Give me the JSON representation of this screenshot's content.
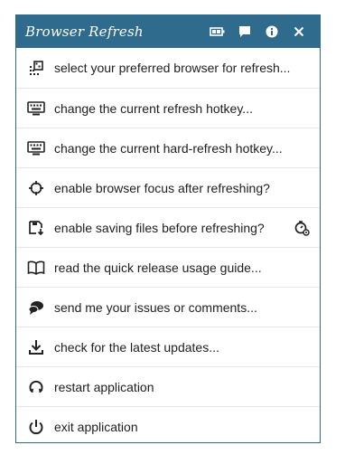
{
  "window": {
    "title": "Browser Refresh"
  },
  "titlebar": {
    "buttons": [
      {
        "icon": "battery-icon"
      },
      {
        "icon": "comment-icon"
      },
      {
        "icon": "info-icon"
      },
      {
        "icon": "close-icon"
      }
    ]
  },
  "menu": {
    "items": [
      {
        "label": "select your preferred browser for refresh...",
        "icon": "browser-select-icon"
      },
      {
        "label": "change the current refresh hotkey...",
        "icon": "keyboard-icon"
      },
      {
        "label": "change the current hard-refresh hotkey...",
        "icon": "keyboard-icon"
      },
      {
        "label": "enable browser focus after refreshing?",
        "icon": "crosshair-icon"
      },
      {
        "label": "enable saving files before refreshing?",
        "icon": "save-icon",
        "extra_icon": "timer-settings-icon"
      },
      {
        "label": "read the quick release usage guide...",
        "icon": "book-icon"
      },
      {
        "label": "send me your issues or comments...",
        "icon": "chat-icon"
      },
      {
        "label": "check for the latest updates...",
        "icon": "download-icon"
      },
      {
        "label": "restart application",
        "icon": "restart-icon"
      },
      {
        "label": "exit application",
        "icon": "power-icon"
      }
    ]
  },
  "colors": {
    "titlebar": "#2f6b8c",
    "border": "#2f6a8b",
    "text": "#1e1e1e",
    "divider": "#e6e6e6"
  }
}
